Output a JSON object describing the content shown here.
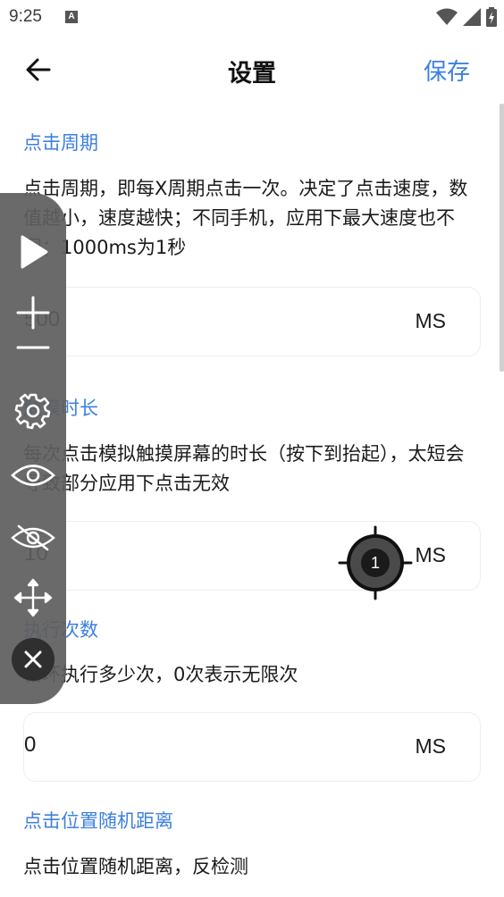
{
  "status_bar": {
    "time": "9:25",
    "notification_letter": "A",
    "icons": [
      "wifi-icon",
      "signal-icon",
      "battery-charging-icon"
    ]
  },
  "app_bar": {
    "back_icon": "arrow-left-icon",
    "title": "设置",
    "save_label": "保存"
  },
  "settings": [
    {
      "title": "点击周期",
      "description": "点击周期，即每X周期点击一次。决定了点击速度，数值越小，速度越快；不同手机，应用下最大速度也不同；1000ms为1秒",
      "value": "500",
      "unit": "MS"
    },
    {
      "title": "触摸时长",
      "description": "每次点击模拟触摸屏幕的时长（按下到抬起），太短会导致部分应用下点击无效",
      "value": "10",
      "unit": "MS"
    },
    {
      "title": "执行次数",
      "description": "循环执行多少次，0次表示无限次",
      "value": "0",
      "unit": "MS"
    },
    {
      "title": "点击位置随机距离",
      "description": "点击位置随机距离，反检测"
    }
  ],
  "floating_panel": {
    "buttons": [
      "play-icon",
      "plus-icon",
      "minus-icon",
      "gear-icon",
      "eye-icon",
      "eye-off-icon",
      "move-icon",
      "close-icon"
    ]
  },
  "click_target": {
    "label": "1"
  },
  "colors": {
    "accent": "#3d7fe0",
    "panel": "#5f5f5f",
    "target_fill": "#4a4a4a"
  }
}
